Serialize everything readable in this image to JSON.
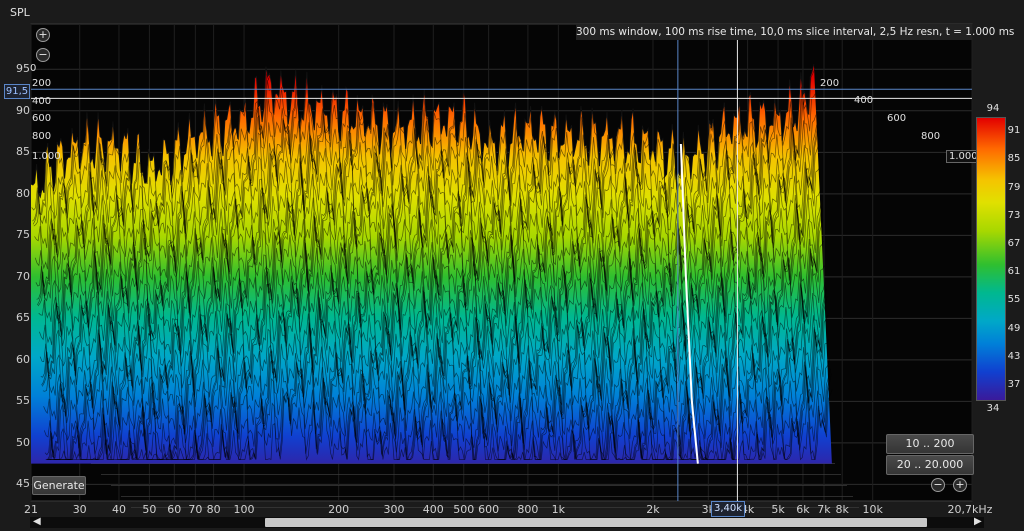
{
  "window": {
    "y_axis_title": "SPL"
  },
  "info": {
    "text": "300 ms window, 100 ms rise time, 10,0 ms slice interval, 2,5 Hz resn, t = 1.000 ms"
  },
  "cursor": {
    "spl_readout": "91,5",
    "freq_readout": "3,40k",
    "spl_value": 91.5,
    "freq_value": 3400
  },
  "buttons": {
    "generate": "Generate",
    "range_time": "10 .. 200",
    "range_freq": "20 .. 20.000",
    "zoom_in_top": "+",
    "zoom_out_top": "−",
    "zoom_out_bottom": "−",
    "zoom_in_bottom": "+"
  },
  "colors": {
    "background": "#1b1b1b",
    "cursor": "#5a86c8"
  },
  "chart_data": {
    "type": "waterfall",
    "y_label": "SPL",
    "ylim": [
      43,
      96
    ],
    "y_ticks": [
      "95",
      "90",
      "85",
      "80",
      "75",
      "70",
      "65",
      "60",
      "55",
      "50",
      "45"
    ],
    "x_scale": "log",
    "xlim": [
      21,
      20700
    ],
    "x_tick_labels": [
      "21",
      "30",
      "40",
      "50",
      "60",
      "70",
      "80",
      "100",
      "200",
      "300",
      "400",
      "500",
      "600",
      "800",
      "1k",
      "2k",
      "3k",
      "4k",
      "5k",
      "6k",
      "7k",
      "8k",
      "10k",
      "20,7kHz"
    ],
    "z_tick_labels_left": [
      "0",
      "200",
      "400",
      "600",
      "800",
      "1.000"
    ],
    "z_tick_labels_right": [
      "200",
      "400",
      "600",
      "800",
      "1.000"
    ],
    "z_unit": "ms",
    "colorbar_ticks": [
      "94",
      "91",
      "85",
      "79",
      "73",
      "67",
      "61",
      "55",
      "49",
      "43",
      "37",
      "34"
    ],
    "colorbar_range": [
      34,
      94
    ],
    "colormap": [
      "#e30000",
      "#ff6a00",
      "#f5c400",
      "#e0e000",
      "#a8d800",
      "#2fbf2f",
      "#00b890",
      "#00a8c8",
      "#0080d8",
      "#1040d0",
      "#3a1a9a"
    ],
    "envelope": {
      "freq_hz": [
        21,
        25,
        30,
        35,
        40,
        50,
        60,
        70,
        80,
        100,
        120,
        150,
        200,
        250,
        300,
        400,
        500,
        600,
        800,
        1000,
        1500,
        2000,
        2500,
        3000,
        3400,
        4000,
        5000,
        6000,
        6500
      ],
      "peak_spl": [
        80,
        84,
        86,
        86,
        86,
        83,
        85,
        87,
        88,
        89,
        93,
        91,
        90,
        89,
        88,
        89,
        89,
        86,
        88,
        87,
        87,
        86,
        84,
        86,
        88,
        89,
        89,
        91,
        95
      ]
    }
  }
}
